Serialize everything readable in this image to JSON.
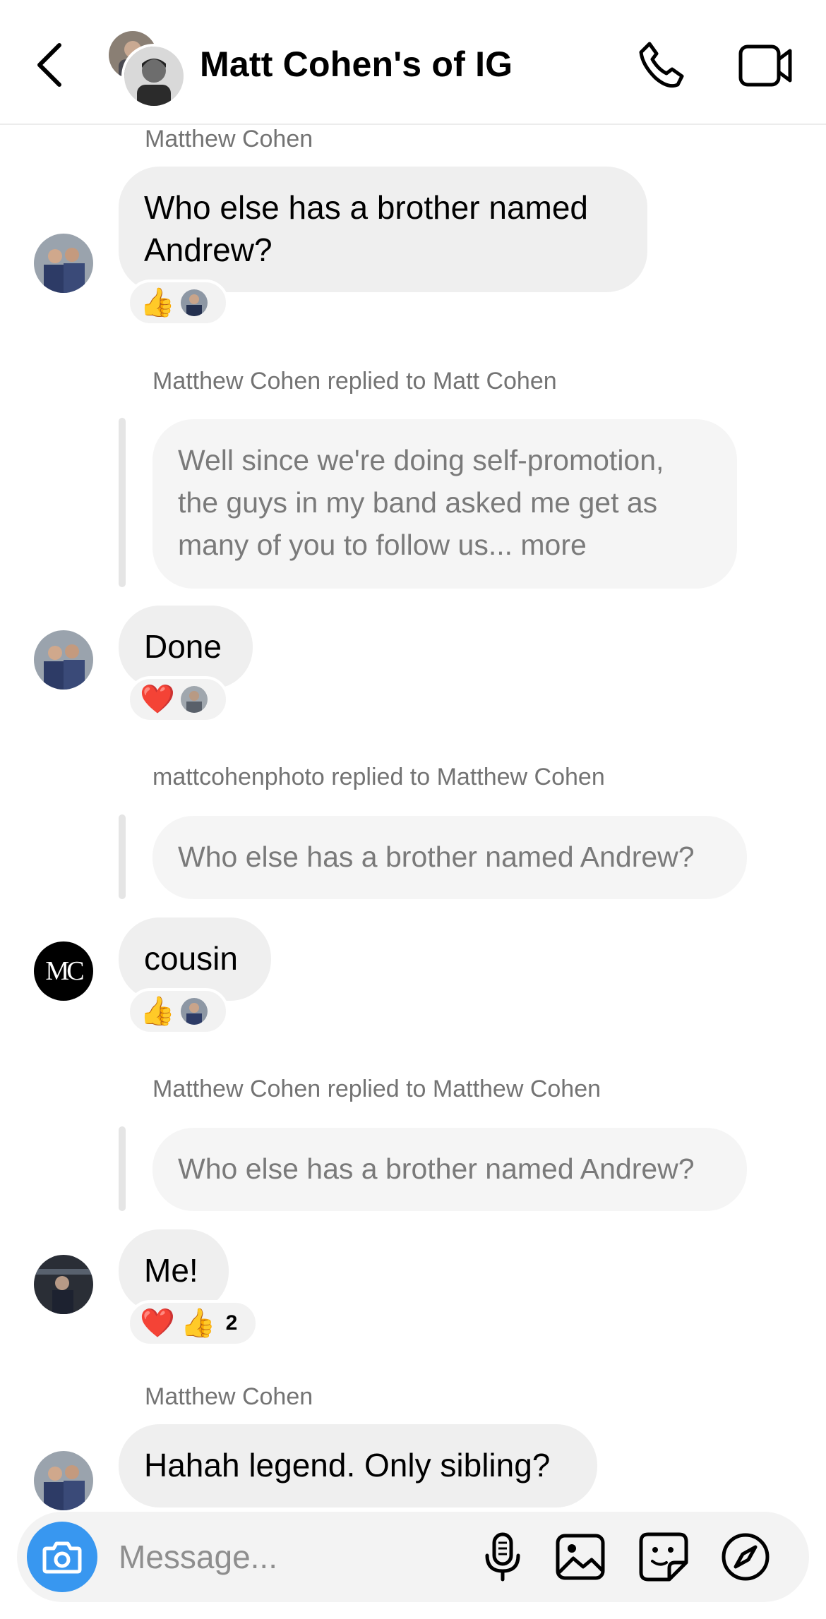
{
  "header": {
    "title": "Matt Cohen's of IG",
    "back_icon": "chevron-left-icon",
    "call_icon": "phone-icon",
    "video_icon": "video-camera-icon"
  },
  "messages": [
    {
      "sender": "Matthew Cohen",
      "text_line1": "Who else has a brother named",
      "text_line2": "Andrew?",
      "reactions": [
        "👍"
      ]
    },
    {
      "reply_header": "Matthew Cohen replied to Matt Cohen",
      "quoted_line1": "Well since we're doing self-promotion,",
      "quoted_line2": "the guys in my band asked me get as",
      "quoted_line3": "many of you to follow us... more",
      "text": "Done",
      "reactions": [
        "❤️"
      ]
    },
    {
      "reply_header": "mattcohenphoto replied to Matthew Cohen",
      "quoted": "Who else has a brother named Andrew?",
      "text": "cousin",
      "reactions": [
        "👍"
      ],
      "avatar_initials": "MC"
    },
    {
      "reply_header": "Matthew Cohen replied to Matthew Cohen",
      "quoted": "Who else has a brother named Andrew?",
      "text": "Me!",
      "reactions": [
        "❤️",
        "👍"
      ],
      "reaction_count": "2"
    },
    {
      "sender": "Matthew Cohen",
      "text": "Hahah legend. Only sibling?"
    }
  ],
  "composer": {
    "placeholder": "Message...",
    "icons": [
      "camera-icon",
      "microphone-icon",
      "image-icon",
      "sticker-icon",
      "compass-icon"
    ]
  },
  "colors": {
    "accent": "#3897f0",
    "bubble": "#efefef",
    "secondary_text": "#737373"
  }
}
